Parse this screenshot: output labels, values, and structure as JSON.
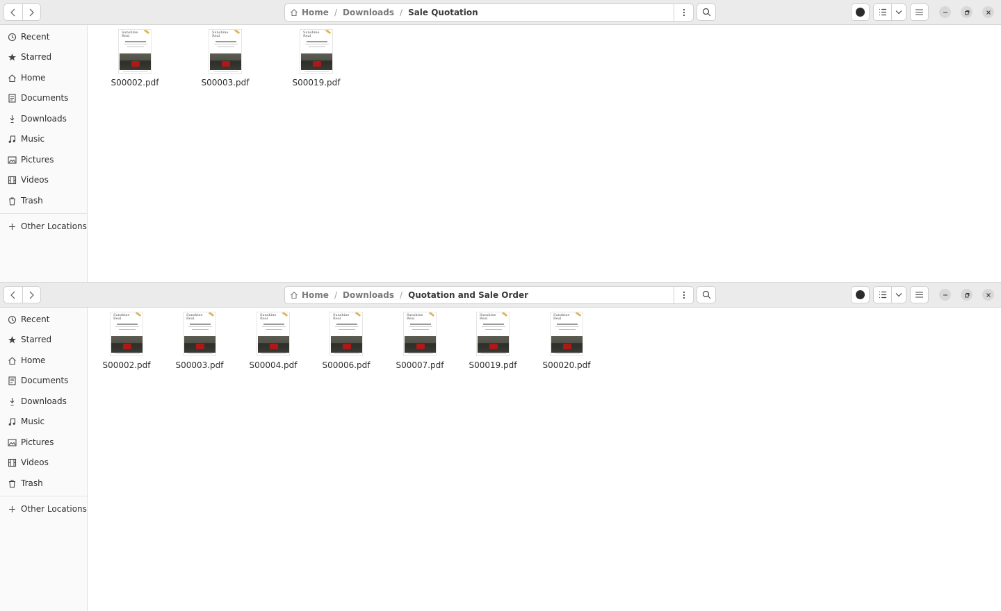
{
  "windows": [
    {
      "id": "top",
      "path": [
        {
          "label": "Home",
          "icon": "home-icon"
        },
        {
          "label": "Downloads"
        },
        {
          "label": "Sale Quotation",
          "current": true
        }
      ],
      "files": [
        {
          "name": "S00002.pdf"
        },
        {
          "name": "S00003.pdf"
        },
        {
          "name": "S00019.pdf"
        }
      ]
    },
    {
      "id": "bottom",
      "path": [
        {
          "label": "Home",
          "icon": "home-icon"
        },
        {
          "label": "Downloads"
        },
        {
          "label": "Quotation and Sale Order",
          "current": true
        }
      ],
      "files": [
        {
          "name": "S00002.pdf"
        },
        {
          "name": "S00003.pdf"
        },
        {
          "name": "S00004.pdf"
        },
        {
          "name": "S00006.pdf"
        },
        {
          "name": "S00007.pdf"
        },
        {
          "name": "S00019.pdf"
        },
        {
          "name": "S00020.pdf"
        }
      ]
    }
  ],
  "sidebar": {
    "items": [
      {
        "label": "Recent",
        "icon": "clock-icon"
      },
      {
        "label": "Starred",
        "icon": "star-icon"
      },
      {
        "label": "Home",
        "icon": "home-icon"
      },
      {
        "label": "Documents",
        "icon": "document-icon"
      },
      {
        "label": "Downloads",
        "icon": "download-icon"
      },
      {
        "label": "Music",
        "icon": "music-note-icon"
      },
      {
        "label": "Pictures",
        "icon": "picture-icon"
      },
      {
        "label": "Videos",
        "icon": "film-icon"
      },
      {
        "label": "Trash",
        "icon": "trash-icon"
      }
    ],
    "other_locations": {
      "label": "Other Locations",
      "icon": "plus-icon"
    }
  }
}
